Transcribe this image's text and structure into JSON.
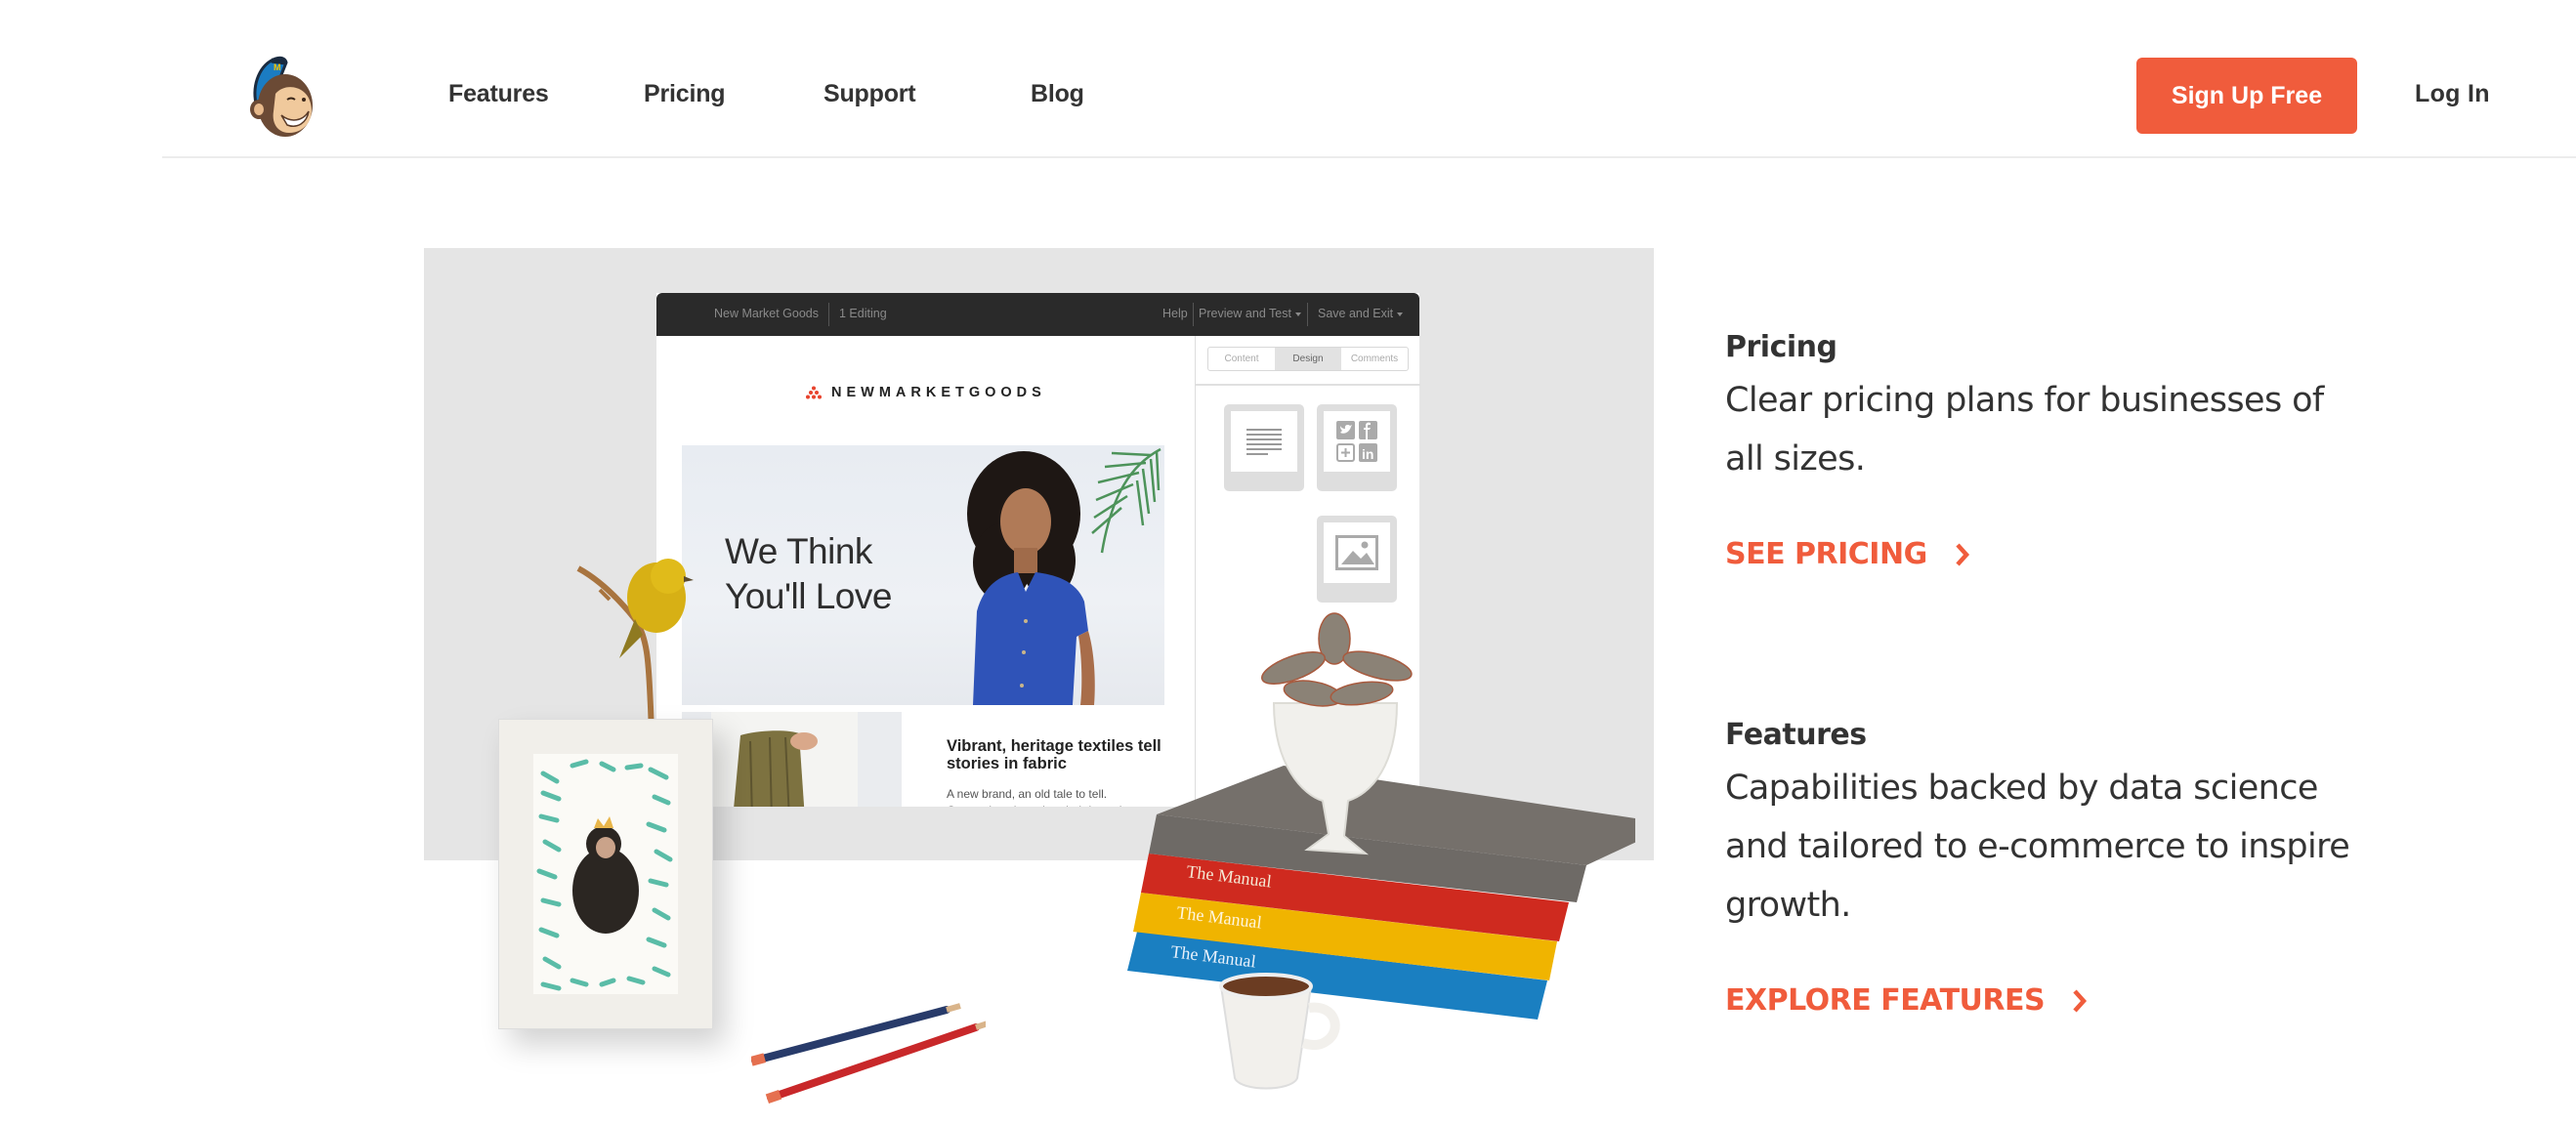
{
  "header": {
    "logo_alt": "Freddie monkey mascot",
    "nav": [
      {
        "label": "Features"
      },
      {
        "label": "Pricing"
      },
      {
        "label": "Support"
      },
      {
        "label": "Blog"
      }
    ],
    "signup_label": "Sign Up Free",
    "login_label": "Log In"
  },
  "mockup": {
    "toolbar": {
      "campaign_name": "New Market Goods",
      "status": "1 Editing",
      "help": "Help",
      "preview": "Preview and Test",
      "save": "Save and Exit"
    },
    "brand_name": "NEWMARKETGOODS",
    "hero_line1": "We Think",
    "hero_line2": "You'll Love",
    "article_title": "Vibrant, heritage textiles tell stories in fabric",
    "article_body_line1": "A new brand, an old tale to tell.",
    "article_body_line2": "Generations have handed down the",
    "sidebar_tabs": [
      {
        "label": "Content",
        "active": false
      },
      {
        "label": "Design",
        "active": true
      },
      {
        "label": "Comments",
        "active": false
      }
    ],
    "content_blocks": [
      "text-block-icon",
      "social-follow-icon",
      "image-block-icon"
    ]
  },
  "props": {
    "book_spine_labels": [
      "The Manual",
      "The Manual",
      "The Manual"
    ]
  },
  "sections": [
    {
      "heading": "Pricing",
      "description": "Clear pricing plans for businesses of all sizes.",
      "cta": "SEE PRICING"
    },
    {
      "heading": "Features",
      "description": "Capabilities backed by data science and tailored to e-commerce to inspire growth.",
      "cta": "EXPLORE FEATURES"
    }
  ],
  "colors": {
    "accent": "#f05c3c",
    "text": "#333333",
    "backdrop": "#e5e5e5",
    "toolbar": "#2a2a2a"
  }
}
